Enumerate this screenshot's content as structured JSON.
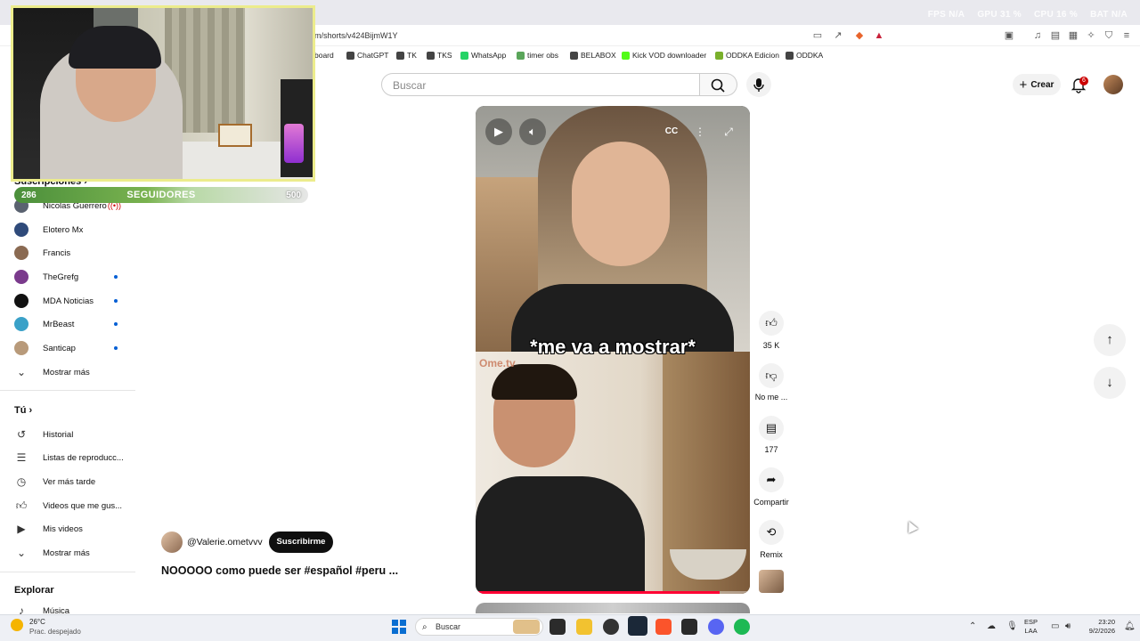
{
  "browser": {
    "url": "m/shorts/v424BijmW1Y",
    "stats": [
      "FPS N/A",
      "GPU 31 %",
      "CPU 16 %",
      "BAT N/A"
    ],
    "bookmarks": [
      "board",
      "ChatGPT",
      "TK",
      "TKS",
      "WhatsApp",
      "timer obs",
      "BELABOX",
      "Kick VOD downloader",
      "ODDKA Edicion",
      "ODDKA"
    ]
  },
  "header": {
    "search_placeholder": "Buscar",
    "create_label": "Crear",
    "notifications_count": "6"
  },
  "stream_overlay": {
    "followers_current": "286",
    "followers_label": "SEGUIDORES",
    "followers_goal": "500",
    "progress_fraction": 0.57
  },
  "sidebar": {
    "subscriptions_header": "Suscripciones",
    "subscriptions": [
      {
        "label": "Nicolas Guerrero",
        "avatar_color": "#5a6270",
        "live": true
      },
      {
        "label": "Elotero Mx",
        "avatar_color": "#2f4a7a",
        "new": false
      },
      {
        "label": "Francis",
        "avatar_color": "#8a6a52",
        "new": false
      },
      {
        "label": "TheGrefg",
        "avatar_color": "#7a3a8c",
        "new": true
      },
      {
        "label": "MDA Noticias",
        "avatar_color": "#111111",
        "new": true
      },
      {
        "label": "MrBeast",
        "avatar_color": "#3aa1c8",
        "new": true
      },
      {
        "label": "Santicap",
        "avatar_color": "#b89a7a",
        "new": true
      }
    ],
    "show_more_1": "Mostrar más",
    "you_header": "Tú",
    "you_items": [
      {
        "label": "Historial",
        "icon": "history-icon"
      },
      {
        "label": "Listas de reproducc...",
        "icon": "playlist-icon"
      },
      {
        "label": "Ver más tarde",
        "icon": "clock-icon"
      },
      {
        "label": "Videos que me gus...",
        "icon": "thumbs-up-icon"
      },
      {
        "label": "Mis videos",
        "icon": "video-icon"
      }
    ],
    "show_more_2": "Mostrar más",
    "explore_header": "Explorar",
    "explore_items": [
      {
        "label": "Música",
        "icon": "music-icon"
      }
    ]
  },
  "short": {
    "caption": "*me va a mostrar*",
    "overlay_logo": "Ome.tv",
    "progress_fraction": 0.89,
    "channel": "@Valerie.ometvvv",
    "subscribe_label": "Suscribirme",
    "title": "NOOOOO como puede ser #español #peru ...",
    "likes": "35 K",
    "dislike_label": "No me ...",
    "comments": "177",
    "share_label": "Compartir",
    "remix_label": "Remix"
  },
  "taskbar": {
    "weather_temp": "26°C",
    "weather_desc": "Prac. despejado",
    "search_label": "Buscar",
    "lang_top": "ESP",
    "lang_bottom": "LAA",
    "time": "23:20",
    "date": "9/2/2026"
  }
}
